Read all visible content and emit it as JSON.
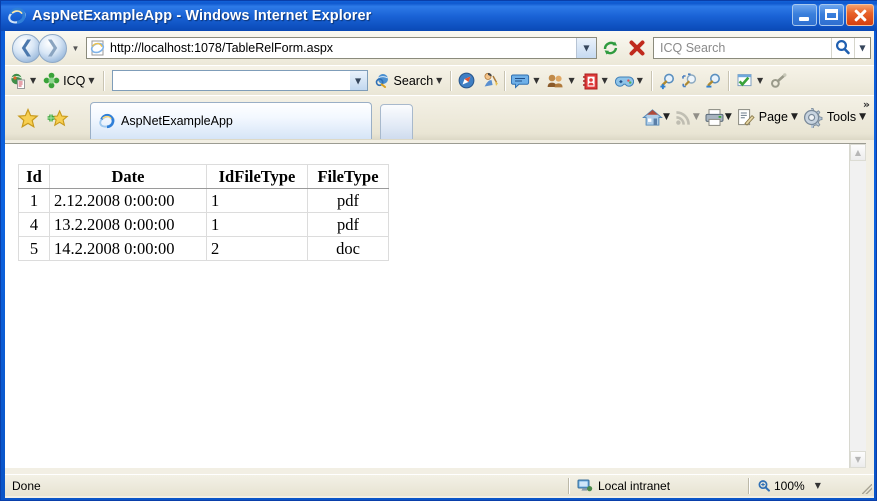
{
  "window": {
    "title": "AspNetExampleApp - Windows Internet Explorer",
    "app_icon": "ie-logo-icon",
    "minimize_label": "Minimize",
    "maximize_label": "Maximize",
    "close_label": "Close"
  },
  "nav": {
    "back_label": "Back",
    "forward_label": "Forward",
    "recent_pages_label": "Recent Pages",
    "address": {
      "favicon": "ie-page-icon",
      "url": "http://localhost:1078/TableRelForm.aspx",
      "dropdown_label": "Address history"
    },
    "refresh_label": "Refresh",
    "stop_label": "Stop",
    "search": {
      "placeholder": "ICQ Search",
      "value": "",
      "go_icon": "magnifier-icon",
      "provider_dropdown_label": "Search options"
    }
  },
  "icq_toolbar": {
    "items": [
      {
        "icon": "icq-globe-page-icon",
        "label": "",
        "has_caret": true
      },
      {
        "icon": "icq-flower-icon",
        "label": "ICQ",
        "has_caret": true
      }
    ],
    "combo": {
      "value": "",
      "dropdown_label": "ICQ search history"
    },
    "search_button": {
      "icon": "globe-search-icon",
      "label": "Search",
      "has_caret": true
    },
    "buttons": [
      {
        "icon": "compass-icon",
        "has_caret": false
      },
      {
        "icon": "person-broom-icon",
        "has_caret": false
      },
      {
        "icon": "chat-bubble-icon",
        "has_caret": true
      },
      {
        "icon": "buddies-icon",
        "has_caret": true
      },
      {
        "icon": "address-book-icon",
        "has_caret": true
      },
      {
        "icon": "games-controller-icon",
        "has_caret": true
      },
      {
        "icon": "zoom-in-icon",
        "has_caret": false
      },
      {
        "icon": "zoom-select-icon",
        "has_caret": false
      },
      {
        "icon": "zoom-out-icon",
        "has_caret": false
      },
      {
        "icon": "check-window-icon",
        "has_caret": true
      },
      {
        "icon": "flashlight-icon",
        "has_caret": false
      }
    ]
  },
  "tabbar": {
    "favorites_center_label": "Favorites Center",
    "add_favorite_label": "Add to Favorites",
    "tabs": [
      {
        "title": "AspNetExampleApp",
        "icon": "ie-page-icon",
        "active": true
      }
    ],
    "new_tab_label": "New Tab",
    "tools": [
      {
        "icon": "home-icon",
        "label": "",
        "has_caret": true,
        "disabled": false
      },
      {
        "icon": "rss-feed-icon",
        "label": "",
        "has_caret": true,
        "disabled": true
      },
      {
        "icon": "printer-icon",
        "label": "",
        "has_caret": true,
        "disabled": false
      },
      {
        "icon": "page-icon",
        "label": "Page",
        "has_caret": true,
        "disabled": false
      },
      {
        "icon": "gear-icon",
        "label": "Tools",
        "has_caret": true,
        "disabled": false
      }
    ],
    "overflow_label": "»"
  },
  "content": {
    "table": {
      "headers": [
        "Id",
        "Date",
        "IdFileType",
        "FileType"
      ],
      "rows": [
        [
          "1",
          "2.12.2008 0:00:00",
          "1",
          "pdf"
        ],
        [
          "4",
          "13.2.2008 0:00:00",
          "1",
          "pdf"
        ],
        [
          "5",
          "14.2.2008 0:00:00",
          "2",
          "doc"
        ]
      ]
    }
  },
  "scrollbar": {
    "up_arrow": "chevron-up-icon",
    "down_arrow": "chevron-down-icon",
    "enabled": false
  },
  "statusbar": {
    "status_text": "Done",
    "zone": {
      "icon": "network-monitor-icon",
      "label": "Local intranet"
    },
    "zoom": {
      "icon": "magnifier-icon",
      "label": "100%",
      "caret": true
    }
  },
  "colors": {
    "titlebar_blue": "#0f59cf",
    "chrome_beige": "#f2efe4",
    "content_white": "#ffffff",
    "table_border": "#dcdcdc",
    "header_rule": "#9a9a9a"
  }
}
